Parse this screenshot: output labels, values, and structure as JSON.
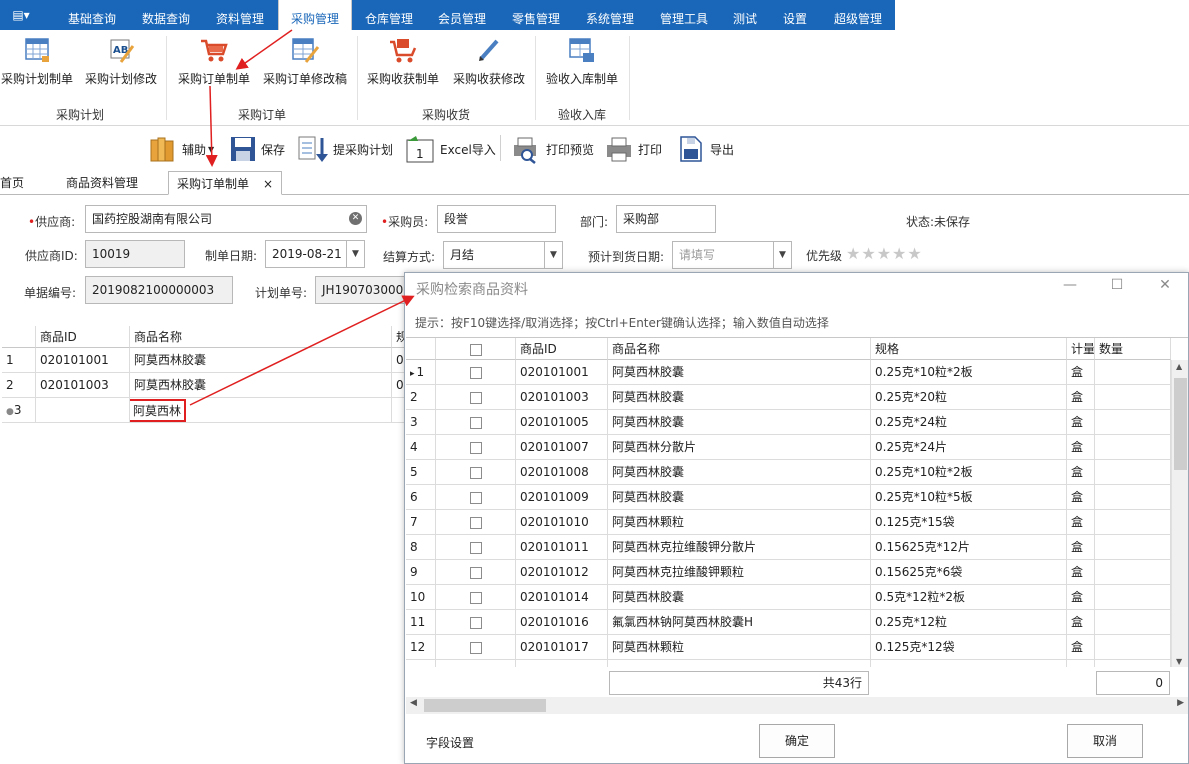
{
  "menu": {
    "app_glyph": "▤▾",
    "tabs": [
      {
        "label": "基础查询"
      },
      {
        "label": "数据查询"
      },
      {
        "label": "资料管理"
      },
      {
        "label": "采购管理",
        "active": true
      },
      {
        "label": "仓库管理"
      },
      {
        "label": "会员管理"
      },
      {
        "label": "零售管理"
      },
      {
        "label": "系统管理"
      },
      {
        "label": "管理工具"
      },
      {
        "label": "测试"
      },
      {
        "label": "设置"
      },
      {
        "label": "超级管理"
      }
    ]
  },
  "ribbon": {
    "groups": [
      {
        "label": "采购计划",
        "buttons": [
          {
            "label": "采购计划制单",
            "icon": "grid-sheet-icon"
          },
          {
            "label": "采购计划修改",
            "icon": "ab-edit-icon"
          }
        ]
      },
      {
        "label": "采购订单",
        "buttons": [
          {
            "label": "采购订单制单",
            "icon": "cart-icon"
          },
          {
            "label": "采购订单修改稿",
            "icon": "sheet-edit-icon"
          }
        ]
      },
      {
        "label": "采购收货",
        "buttons": [
          {
            "label": "采购收获制单",
            "icon": "cart-box-icon"
          },
          {
            "label": "采购收获修改",
            "icon": "pencil-icon"
          }
        ]
      },
      {
        "label": "验收入库",
        "buttons": [
          {
            "label": "验收入库制单",
            "icon": "sheet-check-icon"
          }
        ]
      }
    ]
  },
  "toolbar": {
    "aux": "辅助",
    "save": "保存",
    "pull_plan": "提采购计划",
    "excel_import": "Excel导入",
    "excel_badge": "1",
    "print_preview": "打印预览",
    "print": "打印",
    "export": "导出"
  },
  "doc_tabs": {
    "home": "首页",
    "goods": "商品资料管理",
    "order": "采购订单制单",
    "close": "×"
  },
  "form": {
    "supplier_label": "供应商:",
    "supplier_value": "国药控股湖南有限公司",
    "buyer_label": "采购员:",
    "buyer_value": "段誉",
    "dept_label": "部门:",
    "dept_value": "采购部",
    "status_label": "状态:",
    "status_value": "未保存",
    "supplier_id_label": "供应商ID:",
    "supplier_id_value": "10019",
    "date_label": "制单日期:",
    "date_value": "2019-08-21",
    "settle_label": "结算方式:",
    "settle_value": "月结",
    "arrive_label": "预计到货日期:",
    "arrive_placeholder": "请填写",
    "priority_label": "优先级",
    "priority_stars": "★★★★★",
    "doc_no_label": "单据编号:",
    "doc_no_value": "2019082100000003",
    "plan_no_label": "计划单号:",
    "plan_no_value": "JH19070300002"
  },
  "main_grid": {
    "headers": {
      "id": "商品ID",
      "name": "商品名称",
      "spec": "规"
    },
    "rows": [
      {
        "no": "1",
        "id": "020101001",
        "name": "阿莫西林胶囊",
        "spec": "0"
      },
      {
        "no": "2",
        "id": "020101003",
        "name": "阿莫西林胶囊",
        "spec": "0"
      },
      {
        "no": "3",
        "id": "",
        "name": "阿莫西林",
        "spec": ""
      }
    ]
  },
  "dialog": {
    "title": "采购检索商品资料",
    "minimize": "—",
    "maximize": "☐",
    "close": "✕",
    "hint": "提示：按F10键选择/取消选择；按Ctrl+Enter键确认选择；输入数值自动选择",
    "headers": {
      "id": "商品ID",
      "name": "商品名称",
      "spec": "规格",
      "unit": "计量",
      "qty": "数量"
    },
    "rows": [
      {
        "no": "1",
        "id": "020101001",
        "name": "阿莫西林胶囊",
        "spec": "0.25克*10粒*2板",
        "unit": "盒"
      },
      {
        "no": "2",
        "id": "020101003",
        "name": "阿莫西林胶囊",
        "spec": "0.25克*20粒",
        "unit": "盒"
      },
      {
        "no": "3",
        "id": "020101005",
        "name": "阿莫西林胶囊",
        "spec": "0.25克*24粒",
        "unit": "盒"
      },
      {
        "no": "4",
        "id": "020101007",
        "name": "阿莫西林分散片",
        "spec": "0.25克*24片",
        "unit": "盒"
      },
      {
        "no": "5",
        "id": "020101008",
        "name": "阿莫西林胶囊",
        "spec": "0.25克*10粒*2板",
        "unit": "盒"
      },
      {
        "no": "6",
        "id": "020101009",
        "name": "阿莫西林胶囊",
        "spec": "0.25克*10粒*5板",
        "unit": "盒"
      },
      {
        "no": "7",
        "id": "020101010",
        "name": "阿莫西林颗粒",
        "spec": "0.125克*15袋",
        "unit": "盒"
      },
      {
        "no": "8",
        "id": "020101011",
        "name": "阿莫西林克拉维酸钾分散片",
        "spec": "0.15625克*12片",
        "unit": "盒"
      },
      {
        "no": "9",
        "id": "020101012",
        "name": "阿莫西林克拉维酸钾颗粒",
        "spec": "0.15625克*6袋",
        "unit": "盒"
      },
      {
        "no": "10",
        "id": "020101014",
        "name": "阿莫西林胶囊",
        "spec": "0.5克*12粒*2板",
        "unit": "盒"
      },
      {
        "no": "11",
        "id": "020101016",
        "name": "氟氯西林钠阿莫西林胶囊H",
        "spec": "0.25克*12粒",
        "unit": "盒"
      },
      {
        "no": "12",
        "id": "020101017",
        "name": "阿莫西林颗粒",
        "spec": "0.125克*12袋",
        "unit": "盒"
      }
    ],
    "total": "共43行",
    "qty_total": "0",
    "field_settings": "字段设置",
    "ok": "确定",
    "cancel": "取消"
  }
}
